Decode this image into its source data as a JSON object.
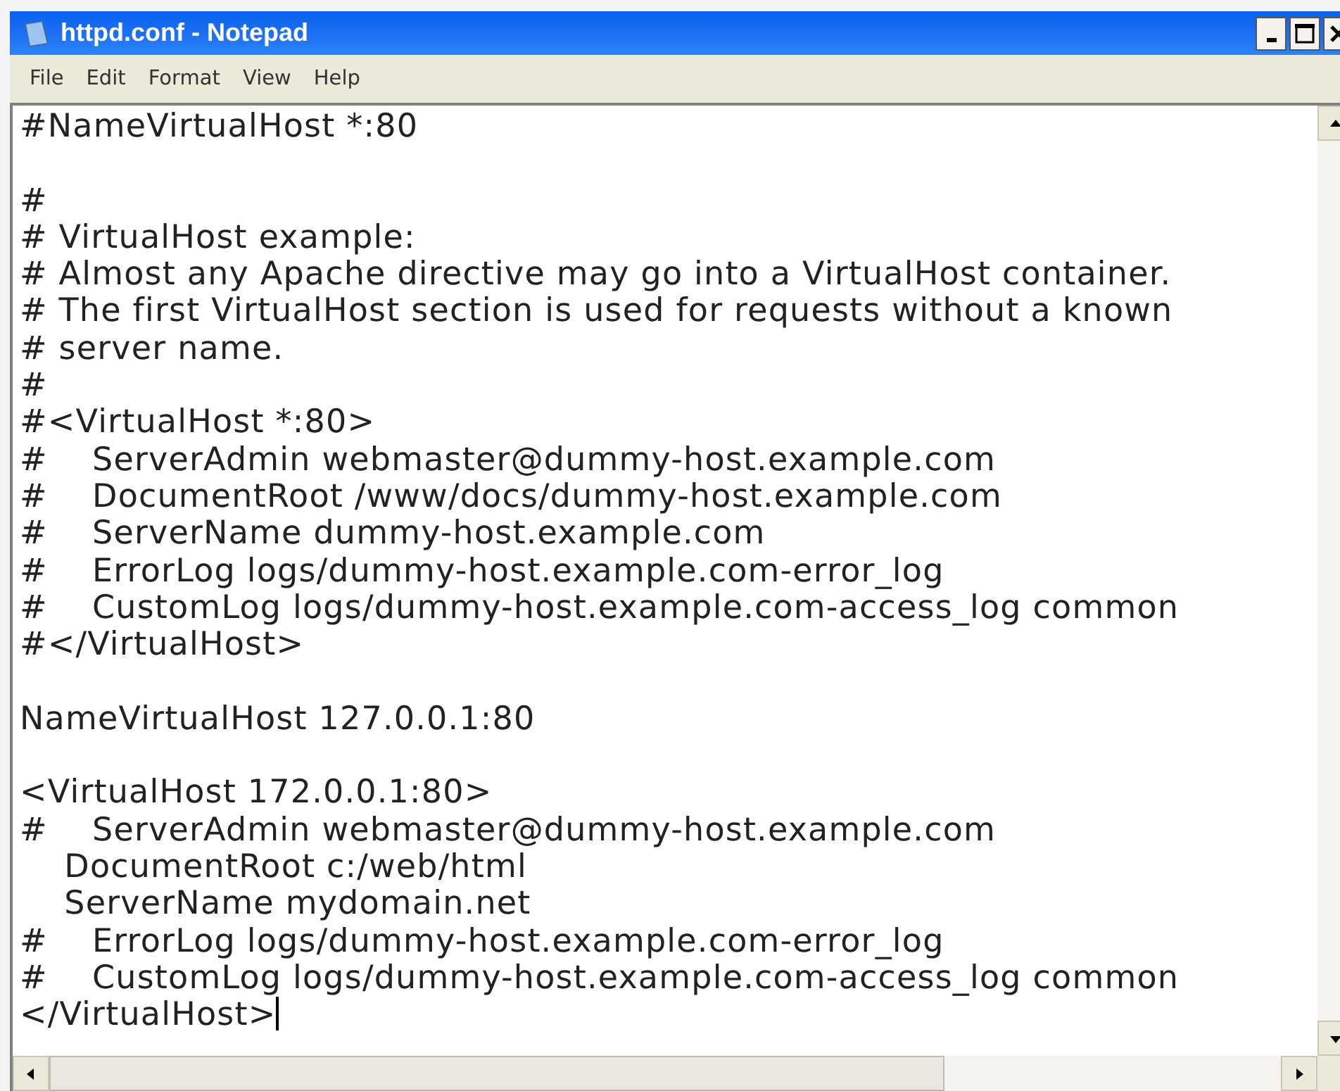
{
  "window": {
    "title": "httpd.conf - Notepad"
  },
  "menu": [
    "File",
    "Edit",
    "Format",
    "View",
    "Help"
  ],
  "editor": {
    "text": "#NameVirtualHost *:80\n\n#\n# VirtualHost example:\n# Almost any Apache directive may go into a VirtualHost container.\n# The first VirtualHost section is used for requests without a known\n# server name.\n#\n#<VirtualHost *:80>\n#    ServerAdmin webmaster@dummy-host.example.com\n#    DocumentRoot /www/docs/dummy-host.example.com\n#    ServerName dummy-host.example.com\n#    ErrorLog logs/dummy-host.example.com-error_log\n#    CustomLog logs/dummy-host.example.com-access_log common\n#</VirtualHost>\n\nNameVirtualHost 127.0.0.1:80\n\n<VirtualHost 172.0.0.1:80>\n#    ServerAdmin webmaster@dummy-host.example.com\n    DocumentRoot c:/web/html\n    ServerName mydomain.net\n#    ErrorLog logs/dummy-host.example.com-error_log\n#    CustomLog logs/dummy-host.example.com-access_log common\n</VirtualHost>"
  }
}
